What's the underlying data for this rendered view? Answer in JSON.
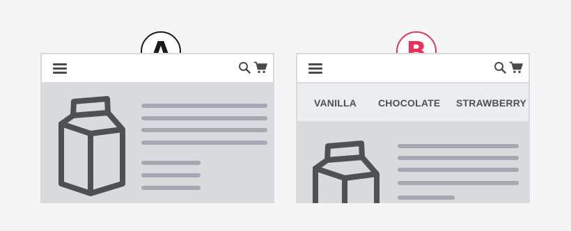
{
  "panels": [
    {
      "badge": "A",
      "topbar": {
        "menu_icon": "hamburger-menu-icon",
        "search_icon": "search-icon",
        "cart_icon": "cart-icon"
      },
      "product_icon": "milk-carton-icon",
      "content_lines": "placeholder-text-lines"
    },
    {
      "badge": "B",
      "topbar": {
        "menu_icon": "hamburger-menu-icon",
        "search_icon": "search-icon",
        "cart_icon": "cart-icon"
      },
      "category_tabs": [
        "VANILLA",
        "CHOCOLATE",
        "STRAWBERRY"
      ],
      "product_icon": "milk-carton-icon",
      "content_lines": "placeholder-text-lines"
    }
  ],
  "colors": {
    "badge_a": "#1a1a1a",
    "badge_b": "#e8325a",
    "icon": "#4a4a4d",
    "content_bg": "#d9dadd",
    "nav_bg": "#ebedf0",
    "line": "#a6a8b1"
  }
}
